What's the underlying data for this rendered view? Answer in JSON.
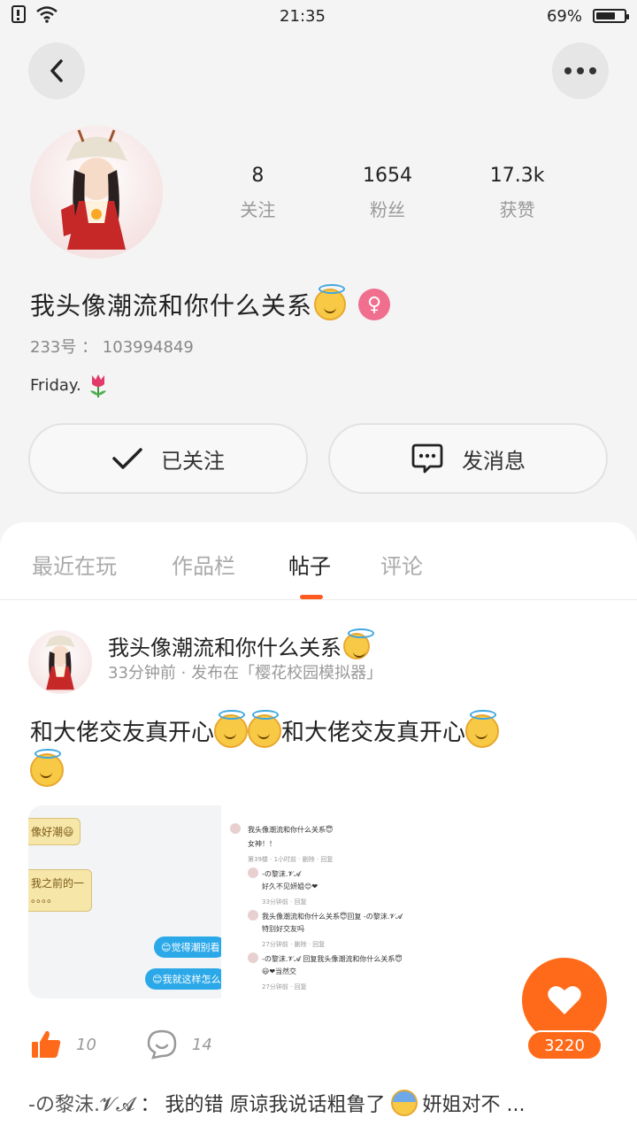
{
  "status": {
    "time": "21:35",
    "battery": "69%",
    "battery_level": 0.69
  },
  "profile": {
    "stats": [
      {
        "value": "8",
        "label": "关注"
      },
      {
        "value": "1654",
        "label": "粉丝"
      },
      {
        "value": "17.3k",
        "label": "获赞"
      }
    ],
    "username": "我头像潮流和你什么关系",
    "gender_symbol": "♀",
    "account_id": "233号 ： 103994849",
    "bio": "Friday.",
    "follow_label": "已关注",
    "message_label": "发消息"
  },
  "tabs": [
    {
      "label": "最近在玩",
      "active": false
    },
    {
      "label": "作品栏",
      "active": false
    },
    {
      "label": "帖子",
      "active": true
    },
    {
      "label": "评论",
      "active": false
    }
  ],
  "post": {
    "author": "我头像潮流和你什么关系",
    "meta": "33分钟前 · 发布在「樱花校园模拟器」",
    "text_part1": "和大佬交友真开心",
    "text_part2": "和大佬交友真开心",
    "image": {
      "left_bubbles": [
        "像好潮😃",
        "我之前的一",
        "。。。。",
        "😊觉得潮别看",
        "😊我就这样怎么"
      ],
      "right_lines": [
        "我头像潮流和你什么关系😇",
        "女神！！",
        "第39楼 · 1小时前 · 删除 · 回复",
        "-の黎沫.𝓥𝓐",
        "好久不见妍姐😊❤",
        "33分钟前 · 回复",
        "我头像潮流和你什么关系😇回复 -の黎沫.𝓥𝓐",
        "特别好交友吗",
        "27分钟前 · 删除 · 回复",
        "-の黎沫.𝓥𝓐 回复我头像潮流和你什么关系😇",
        "😃❤当然交",
        "27分钟前 · 回复"
      ]
    },
    "like_count": "10",
    "comment_count": "14",
    "heart_count": "3220"
  },
  "comment_preview": {
    "author": "-の黎沫.𝓥𝓐",
    "separator": "：",
    "text": "我的错 原谅我说话粗鲁了",
    "text_tail": "妍姐对不 ..."
  },
  "colors": {
    "accent": "#ff6a1a",
    "badge_pink": "#f06e8e"
  }
}
